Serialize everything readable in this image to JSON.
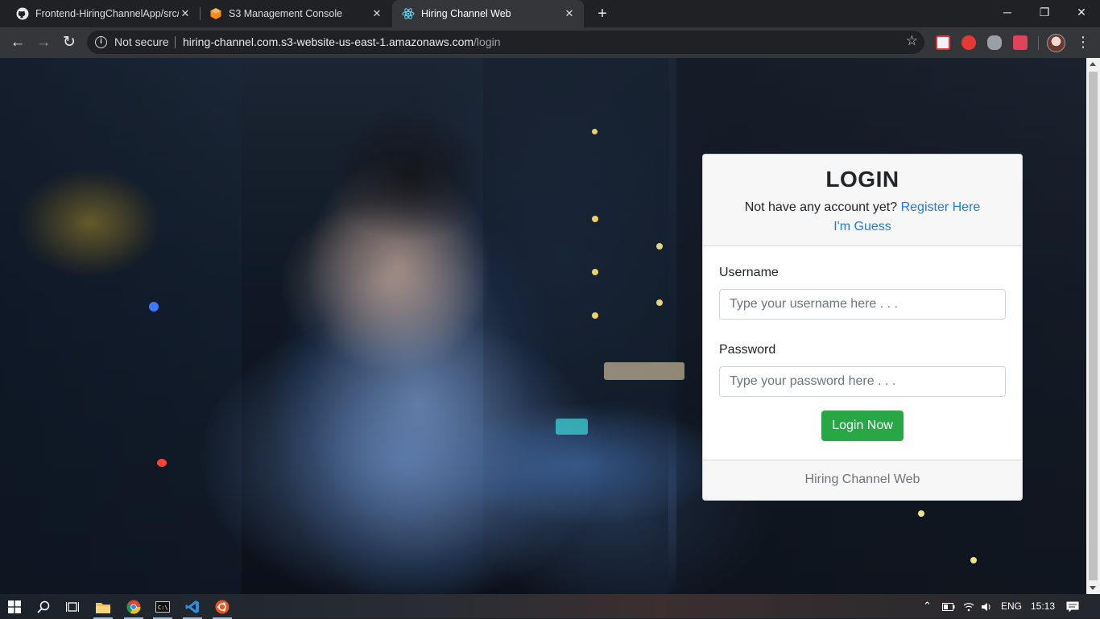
{
  "browser": {
    "tabs": [
      {
        "title": "Frontend-HiringChannelApp/src/",
        "icon": "github-icon",
        "active": false
      },
      {
        "title": "S3 Management Console",
        "icon": "aws-s3-icon",
        "active": false
      },
      {
        "title": "Hiring Channel Web",
        "icon": "react-icon",
        "active": true
      }
    ],
    "security_label": "Not secure",
    "url_host": "hiring-channel.com.s3-website-us-east-1.amazonaws.com",
    "url_path": "/login",
    "window_controls": {
      "minimize": "─",
      "restore": "❐",
      "close": "✕"
    }
  },
  "login": {
    "title": "LOGIN",
    "prompt": "Not have any account yet?",
    "register_link": "Register Here",
    "guest_link": "I'm Guess",
    "username_label": "Username",
    "username_placeholder": "Type your username here . . .",
    "password_label": "Password",
    "password_placeholder": "Type your password here . . .",
    "submit_label": "Login Now",
    "footer": "Hiring Channel Web"
  },
  "colors": {
    "link": "#1e7be6",
    "button": "#28a745",
    "card_header": "#f7f7f7"
  },
  "taskbar": {
    "apps": [
      "windows-start-icon",
      "search-icon",
      "task-view-icon",
      "file-explorer-icon",
      "chrome-icon",
      "terminal-icon",
      "vscode-icon",
      "ubuntu-icon"
    ],
    "language": "ENG",
    "time": "15:13"
  }
}
